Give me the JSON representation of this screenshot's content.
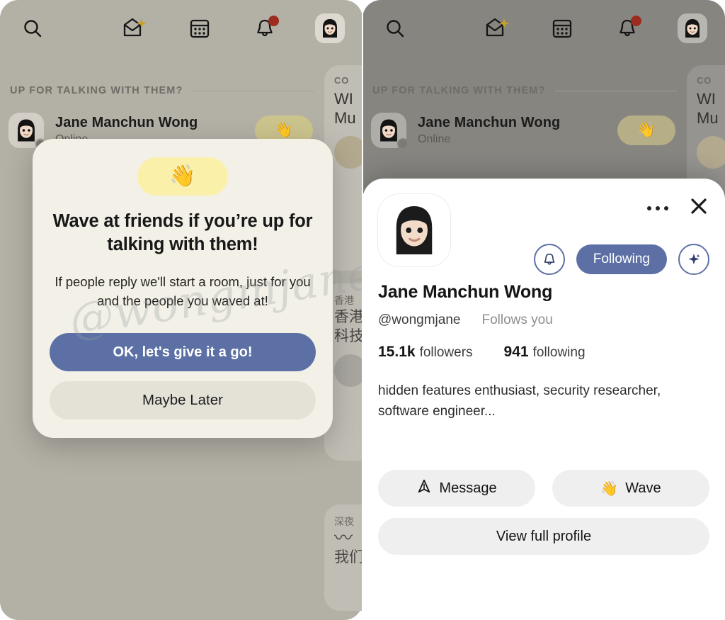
{
  "watermark": {
    "text": "@wongmjane"
  },
  "colors": {
    "accent_blue": "#5c70a5",
    "dialog_bg": "#f3f1e7",
    "dialog_secondary_btn": "#e4e2d7",
    "emoji_pill_yellow": "#fbf0a9",
    "wave_pill_yellow": "#cbc48d",
    "left_panel_bg": "#b3b0a6",
    "right_panel_bg": "#868580",
    "badge_red": "#9c2b20",
    "sheet_button_gray": "#efefef"
  },
  "topbar": {
    "icons": [
      {
        "name": "search-icon",
        "label": "Search"
      },
      {
        "name": "mail-sparkle-icon",
        "label": "Messages"
      },
      {
        "name": "calendar-grid-icon",
        "label": "Calendar"
      },
      {
        "name": "bell-icon",
        "label": "Notifications",
        "has_badge": true
      },
      {
        "name": "avatar-icon",
        "label": "Profile"
      }
    ]
  },
  "feed": {
    "section_label": "UP FOR TALKING WITH THEM?",
    "friend_row": {
      "name": "Jane Manchun Wong",
      "status": "Online",
      "wave_emoji": "👋"
    },
    "peek_cards": [
      {
        "kicker": "CO",
        "title_lines": [
          "WI",
          "Mu"
        ]
      },
      {
        "kicker": "香港",
        "title_lines": [
          "香港",
          "科技"
        ]
      },
      {
        "kicker": "深夜",
        "title_lines": [
          "我们"
        ]
      }
    ]
  },
  "dialog": {
    "emoji": "👋",
    "title": "Wave at friends if you’re up for talking with them!",
    "body": "If people reply we'll start a room, just for you and the people you waved at!",
    "primary_button": "OK, let's give it a go!",
    "secondary_button": "Maybe Later"
  },
  "profile_sheet": {
    "more_label": "More options",
    "close_label": "Close",
    "notify_label": "Notifications",
    "follow_button": "Following",
    "sparkle_label": "Highlights",
    "name": "Jane Manchun Wong",
    "handle": "@wongmjane",
    "follows_you": "Follows you",
    "followers_count": "15.1k",
    "followers_label": "followers",
    "following_count": "941",
    "following_label": "following",
    "bio": "hidden features enthusiast, security researcher, software engineer...",
    "message_button": "Message",
    "wave_button": "Wave",
    "wave_emoji": "👋",
    "view_profile_button": "View full profile"
  }
}
